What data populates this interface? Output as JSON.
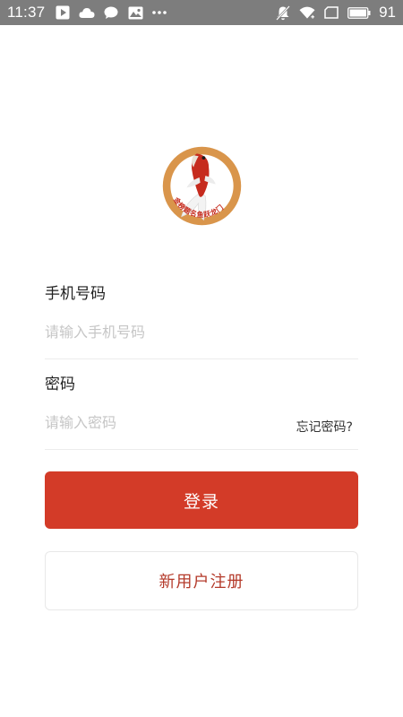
{
  "status_bar": {
    "time": "11:37",
    "battery_percent": "91",
    "icons_left": [
      "play-store-icon",
      "cloud-icon",
      "chat-bubble-icon",
      "image-icon",
      "more-dots-icon"
    ],
    "icons_right": [
      "mute-icon",
      "wifi-icon",
      "sim-icon",
      "battery-icon"
    ],
    "background": "#7d7d7d"
  },
  "logo": {
    "text": "金榜题名鱼跃龙门",
    "icon": "koi-fish-logo-icon",
    "ring_color": "#d9954b",
    "fish_color": "#c62b1e"
  },
  "form": {
    "phone": {
      "label": "手机号码",
      "placeholder": "请输入手机号码",
      "value": ""
    },
    "password": {
      "label": "密码",
      "placeholder": "请输入密码",
      "value": "",
      "forgot_label": "忘记密码?"
    }
  },
  "actions": {
    "login_label": "登录",
    "register_label": "新用户注册",
    "primary_color": "#d33b28"
  }
}
